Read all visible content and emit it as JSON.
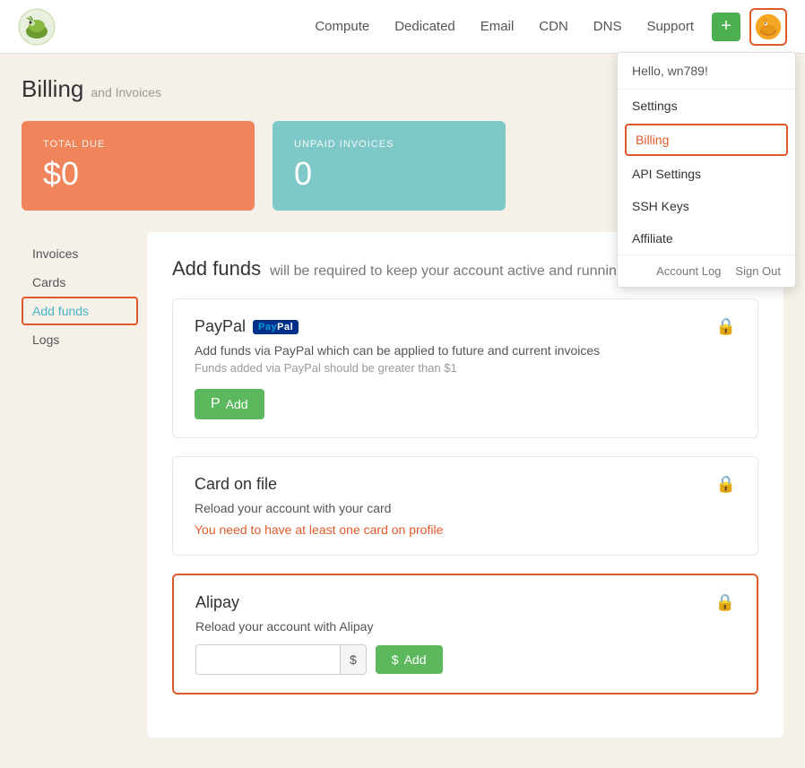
{
  "header": {
    "logo_alt": "Logo",
    "nav": [
      {
        "label": "Compute",
        "id": "compute"
      },
      {
        "label": "Dedicated",
        "id": "dedicated"
      },
      {
        "label": "Email",
        "id": "email"
      },
      {
        "label": "CDN",
        "id": "cdn"
      },
      {
        "label": "DNS",
        "id": "dns"
      },
      {
        "label": "Support",
        "id": "support"
      }
    ],
    "plus_label": "+",
    "avatar_alt": "User avatar"
  },
  "dropdown": {
    "greeting": "Hello, wn789!",
    "items": [
      {
        "label": "Settings",
        "id": "settings",
        "active": false
      },
      {
        "label": "Billing",
        "id": "billing",
        "active": true
      },
      {
        "label": "API Settings",
        "id": "api-settings",
        "active": false
      },
      {
        "label": "SSH Keys",
        "id": "ssh-keys",
        "active": false
      },
      {
        "label": "Affiliate",
        "id": "affiliate",
        "active": false
      }
    ],
    "account_log": "Account Log",
    "sign_out": "Sign Out"
  },
  "billing": {
    "title": "Billing",
    "subtitle": "and Invoices",
    "total_due_label": "TOTAL DUE",
    "total_due_value": "$0",
    "unpaid_invoices_label": "UNPAID INVOICES",
    "unpaid_invoices_value": "0"
  },
  "sidebar": {
    "items": [
      {
        "label": "Invoices",
        "id": "invoices",
        "active": false
      },
      {
        "label": "Cards",
        "id": "cards",
        "active": false
      },
      {
        "label": "Add funds",
        "id": "add-funds",
        "active": true
      },
      {
        "label": "Logs",
        "id": "logs",
        "active": false
      }
    ]
  },
  "content": {
    "title_bold": "Add funds",
    "title_rest": "will be required to keep your account active and running",
    "sections": {
      "paypal": {
        "title": "PayPal",
        "badge_pay": "Pay",
        "badge_pal": "Pal",
        "desc": "Add funds via PayPal which can be applied to future and current invoices",
        "note": "Funds added via PayPal should be greater than $1",
        "add_label": "Add"
      },
      "card": {
        "title": "Card on file",
        "desc": "Reload your account with your card",
        "warning": "You need to have at least one card on profile"
      },
      "alipay": {
        "title": "Alipay",
        "desc": "Reload your account with Alipay",
        "amount_placeholder": "",
        "dollar_sign": "$",
        "add_label": "Add",
        "dollar_prefix": "$"
      }
    }
  }
}
